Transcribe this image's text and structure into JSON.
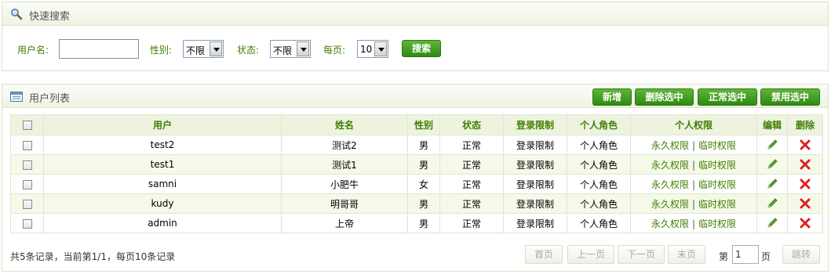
{
  "search": {
    "title": "快速搜索",
    "username_label": "用户名:",
    "username_value": "",
    "gender_label": "性别:",
    "gender_value": "不限",
    "status_label": "状态:",
    "status_value": "不限",
    "perpage_label": "每页:",
    "perpage_value": "10",
    "search_button": "搜索"
  },
  "list": {
    "title": "用户列表",
    "buttons": {
      "add": "新增",
      "delete_selected": "删除选中",
      "normal_selected": "正常选中",
      "disable_selected": "禁用选中"
    },
    "columns": [
      "用户",
      "姓名",
      "性别",
      "状态",
      "登录限制",
      "个人角色",
      "个人权限",
      "编辑",
      "删除"
    ],
    "rows": [
      {
        "user": "test2",
        "name": "测试2",
        "gender": "男",
        "status": "正常",
        "login": "登录限制",
        "role": "个人角色",
        "perm_a": "永久权限",
        "perm_b": "临时权限"
      },
      {
        "user": "test1",
        "name": "测试1",
        "gender": "男",
        "status": "正常",
        "login": "登录限制",
        "role": "个人角色",
        "perm_a": "永久权限",
        "perm_b": "临时权限"
      },
      {
        "user": "samni",
        "name": "小肥牛",
        "gender": "女",
        "status": "正常",
        "login": "登录限制",
        "role": "个人角色",
        "perm_a": "永久权限",
        "perm_b": "临时权限"
      },
      {
        "user": "kudy",
        "name": "明哥哥",
        "gender": "男",
        "status": "正常",
        "login": "登录限制",
        "role": "个人角色",
        "perm_a": "永久权限",
        "perm_b": "临时权限"
      },
      {
        "user": "admin",
        "name": "上帝",
        "gender": "男",
        "status": "正常",
        "login": "登录限制",
        "role": "个人角色",
        "perm_a": "永久权限",
        "perm_b": "临时权限"
      }
    ],
    "separator": "|"
  },
  "pagination": {
    "summary": "共5条记录，当前第1/1，每页10条记录",
    "first": "首页",
    "prev": "上一页",
    "next": "下一页",
    "last": "末页",
    "page_prefix": "第",
    "page_value": "1",
    "page_suffix": "页",
    "go": "跳转"
  },
  "colors": {
    "accent": "#3f7f00",
    "button": "#2f8a12",
    "delete": "#e02020"
  },
  "icons": {
    "search": "magnifier-icon",
    "list": "list-window-icon",
    "edit": "pencil-icon",
    "delete": "red-x-icon"
  }
}
